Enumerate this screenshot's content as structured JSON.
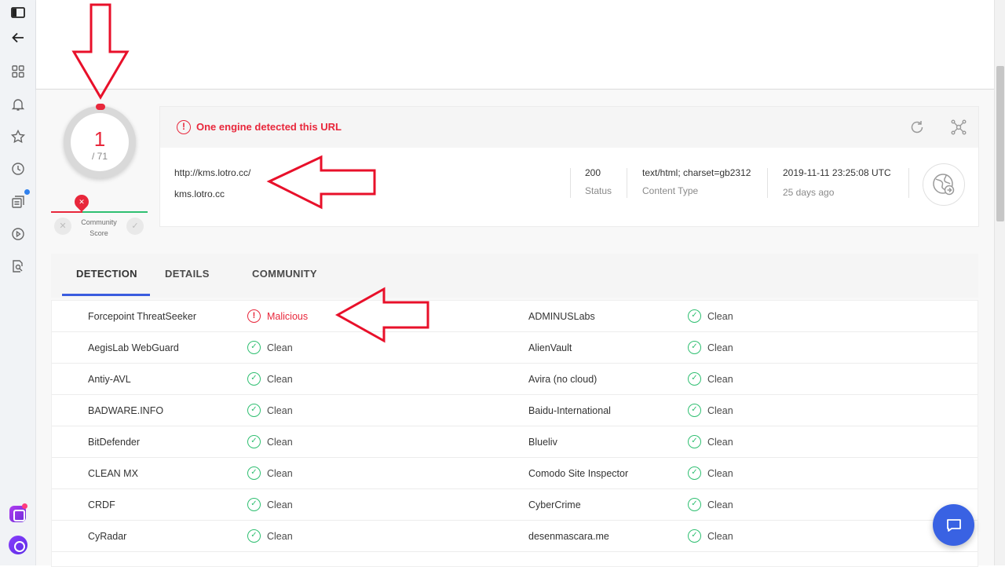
{
  "score": {
    "detected": "1",
    "total": "/ 71"
  },
  "community": {
    "label_line1": "Community",
    "label_line2": "Score",
    "down": "✕",
    "up": "✓",
    "pin": "✕"
  },
  "summary": {
    "alert": "One engine detected this URL",
    "url": "http://kms.lotro.cc/",
    "host": "kms.lotro.cc",
    "status_value": "200",
    "status_label": "Status",
    "content_type_value": "text/html; charset=gb2312",
    "content_type_label": "Content Type",
    "date_value": "2019-11-11 23:25:08 UTC",
    "date_relative": "25 days ago"
  },
  "tabs": [
    "DETECTION",
    "DETAILS",
    "COMMUNITY"
  ],
  "rows": [
    {
      "left_engine": "Forcepoint ThreatSeeker",
      "left_result": "Malicious",
      "right_engine": "ADMINUSLabs",
      "right_result": "Clean"
    },
    {
      "left_engine": "AegisLab WebGuard",
      "left_result": "Clean",
      "right_engine": "AlienVault",
      "right_result": "Clean"
    },
    {
      "left_engine": "Antiy-AVL",
      "left_result": "Clean",
      "right_engine": "Avira (no cloud)",
      "right_result": "Clean"
    },
    {
      "left_engine": "BADWARE.INFO",
      "left_result": "Clean",
      "right_engine": "Baidu-International",
      "right_result": "Clean"
    },
    {
      "left_engine": "BitDefender",
      "left_result": "Clean",
      "right_engine": "Blueliv",
      "right_result": "Clean"
    },
    {
      "left_engine": "CLEAN MX",
      "left_result": "Clean",
      "right_engine": "Comodo Site Inspector",
      "right_result": "Clean"
    },
    {
      "left_engine": "CRDF",
      "left_result": "Clean",
      "right_engine": "CyberCrime",
      "right_result": "Clean"
    },
    {
      "left_engine": "CyRadar",
      "left_result": "Clean",
      "right_engine": "desenmascara.me",
      "right_result": "Clean"
    }
  ],
  "colors": {
    "malicious": "#e8273b",
    "clean": "#2fbf71",
    "accent": "#3a5cdf",
    "annotation": "#e8102a"
  }
}
